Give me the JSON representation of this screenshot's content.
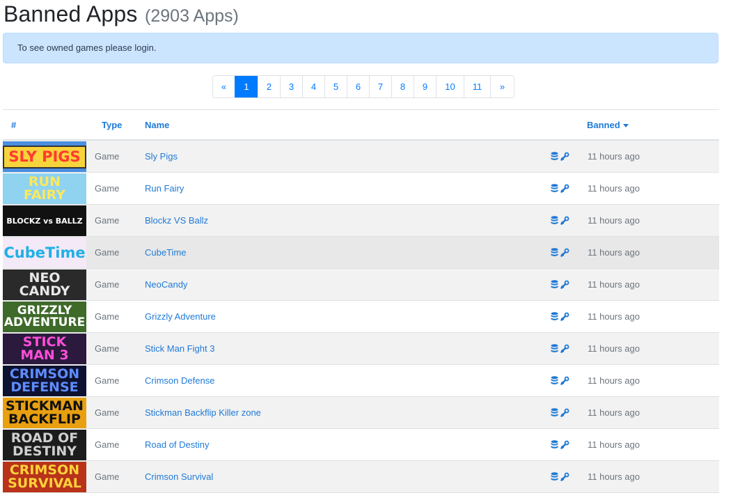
{
  "header": {
    "title": "Banned Apps",
    "count": "(2903 Apps)"
  },
  "alert": {
    "text": "To see owned games please login."
  },
  "pagination": {
    "prev": "«",
    "next": "»",
    "pages": [
      "1",
      "2",
      "3",
      "4",
      "5",
      "6",
      "7",
      "8",
      "9",
      "10",
      "11"
    ],
    "active": "1"
  },
  "table": {
    "columns": {
      "num": "#",
      "type": "Type",
      "name": "Name",
      "banned": "Banned"
    },
    "rows": [
      {
        "type": "Game",
        "name": "Sly Pigs",
        "banned": "11 hours ago",
        "thumb": {
          "lines": [
            "SLY PIGS"
          ],
          "bg": "#4a8fe0",
          "fg": "#ff3b30",
          "box": "#f7d33c"
        }
      },
      {
        "type": "Game",
        "name": "Run Fairy",
        "banned": "11 hours ago",
        "thumb": {
          "lines": [
            "RUN",
            "FAIRY"
          ],
          "bg": "#8fd3f0",
          "fg": "#ffe85a"
        }
      },
      {
        "type": "Game",
        "name": "Blockz VS Ballz",
        "banned": "11 hours ago",
        "thumb": {
          "lines": [
            "BLOCKZ vs BALLZ"
          ],
          "bg": "#111111",
          "fg": "#ffffff"
        }
      },
      {
        "type": "Game",
        "name": "CubeTime",
        "banned": "11 hours ago",
        "thumb": {
          "lines": [
            "CubeTime"
          ],
          "bg": "#f4e9f6",
          "fg": "#1fb0e6"
        }
      },
      {
        "type": "Game",
        "name": "NeoCandy",
        "banned": "11 hours ago",
        "thumb": {
          "lines": [
            "NEO",
            "CANDY"
          ],
          "bg": "#2a2a2a",
          "fg": "#e8e8e8"
        }
      },
      {
        "type": "Game",
        "name": "Grizzly Adventure",
        "banned": "11 hours ago",
        "thumb": {
          "lines": [
            "GRIZZLY",
            "ADVENTURE"
          ],
          "bg": "#3e6a2a",
          "fg": "#ffffff"
        }
      },
      {
        "type": "Game",
        "name": "Stick Man Fight 3",
        "banned": "11 hours ago",
        "thumb": {
          "lines": [
            "STICK",
            "MAN 3"
          ],
          "bg": "#2b1a3d",
          "fg": "#ff4fd8"
        }
      },
      {
        "type": "Game",
        "name": "Crimson Defense",
        "banned": "11 hours ago",
        "thumb": {
          "lines": [
            "CRIMSON",
            "DEFENSE"
          ],
          "bg": "#0d1230",
          "fg": "#5f8cff"
        }
      },
      {
        "type": "Game",
        "name": "Stickman Backflip Killer zone",
        "banned": "11 hours ago",
        "thumb": {
          "lines": [
            "STICKMAN",
            "BACKFLIP"
          ],
          "bg": "#e8a010",
          "fg": "#111111"
        }
      },
      {
        "type": "Game",
        "name": "Road of Destiny",
        "banned": "11 hours ago",
        "thumb": {
          "lines": [
            "ROAD OF",
            "DESTINY"
          ],
          "bg": "#1c1c1c",
          "fg": "#cfcfcf"
        }
      },
      {
        "type": "Game",
        "name": "Crimson Survival",
        "banned": "11 hours ago",
        "thumb": {
          "lines": [
            "CRIMSON",
            "SURVIVAL"
          ],
          "bg": "#b8331a",
          "fg": "#ffd23a"
        }
      }
    ]
  },
  "colors": {
    "link": "#1f7ad6",
    "accent": "#007bff",
    "alert_bg": "#cce5ff"
  },
  "icons": {
    "row_db": "database-icon",
    "row_steam": "steam-icon",
    "sort": "caret-down-icon"
  }
}
